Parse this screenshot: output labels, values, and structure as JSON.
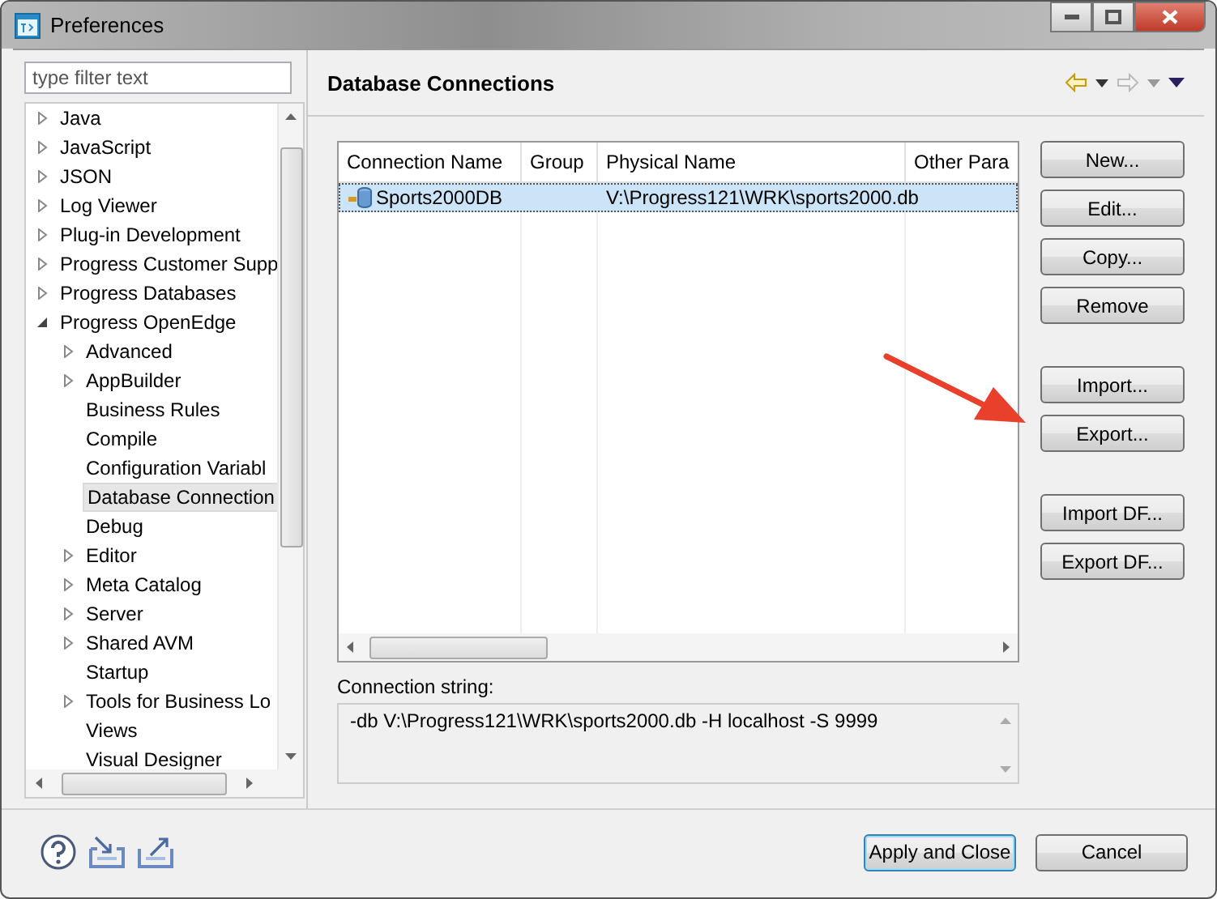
{
  "window": {
    "title": "Preferences"
  },
  "filter": {
    "placeholder": "type filter text"
  },
  "tree": [
    {
      "label": "Java",
      "kind": "branch",
      "expanded": false,
      "selected": false
    },
    {
      "label": "JavaScript",
      "kind": "branch",
      "expanded": false,
      "selected": false
    },
    {
      "label": "JSON",
      "kind": "branch",
      "expanded": false,
      "selected": false
    },
    {
      "label": "Log Viewer",
      "kind": "branch",
      "expanded": false,
      "selected": false
    },
    {
      "label": "Plug-in Development",
      "kind": "branch",
      "expanded": false,
      "selected": false
    },
    {
      "label": "Progress Customer Supp",
      "kind": "branch",
      "expanded": false,
      "selected": false
    },
    {
      "label": "Progress Databases",
      "kind": "branch",
      "expanded": false,
      "selected": false
    },
    {
      "label": "Progress OpenEdge",
      "kind": "branch",
      "expanded": true,
      "selected": false,
      "children": [
        {
          "label": "Advanced",
          "kind": "branch",
          "expanded": false,
          "selected": false
        },
        {
          "label": "AppBuilder",
          "kind": "branch",
          "expanded": false,
          "selected": false
        },
        {
          "label": "Business Rules",
          "kind": "leaf",
          "selected": false
        },
        {
          "label": "Compile",
          "kind": "leaf",
          "selected": false
        },
        {
          "label": "Configuration Variabl",
          "kind": "leaf",
          "selected": false
        },
        {
          "label": "Database Connection",
          "kind": "leaf",
          "selected": true
        },
        {
          "label": "Debug",
          "kind": "leaf",
          "selected": false
        },
        {
          "label": "Editor",
          "kind": "branch",
          "expanded": false,
          "selected": false
        },
        {
          "label": "Meta Catalog",
          "kind": "branch",
          "expanded": false,
          "selected": false
        },
        {
          "label": "Server",
          "kind": "branch",
          "expanded": false,
          "selected": false
        },
        {
          "label": "Shared AVM",
          "kind": "branch",
          "expanded": false,
          "selected": false
        },
        {
          "label": "Startup",
          "kind": "leaf",
          "selected": false
        },
        {
          "label": "Tools for Business Lo",
          "kind": "branch",
          "expanded": false,
          "selected": false
        },
        {
          "label": "Views",
          "kind": "leaf",
          "selected": false
        },
        {
          "label": "Visual Designer",
          "kind": "leaf",
          "selected": false
        }
      ]
    }
  ],
  "page": {
    "title": "Database Connections"
  },
  "table": {
    "columns": [
      "Connection Name",
      "Group",
      "Physical Name",
      "Other Para"
    ],
    "rows": [
      {
        "cells": [
          "Sports2000DB",
          "",
          "V:\\Progress121\\WRK\\sports2000.db",
          ""
        ],
        "selected": true
      }
    ]
  },
  "connection_string": {
    "label": "Connection string:",
    "value": "-db V:\\Progress121\\WRK\\sports2000.db -H localhost -S 9999"
  },
  "side_button_groups": [
    [
      "New...",
      "Edit...",
      "Copy...",
      "Remove"
    ],
    [
      "Import...",
      "Export..."
    ],
    [
      "Import DF...",
      "Export DF..."
    ]
  ],
  "buttons": [
    {
      "label": "Apply and Close",
      "default": true
    },
    {
      "label": "Cancel",
      "default": false
    }
  ]
}
